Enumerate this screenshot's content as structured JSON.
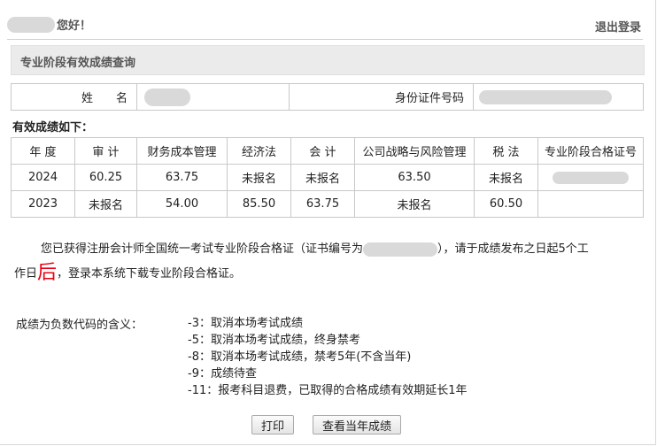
{
  "header": {
    "greeting": "您好！",
    "logout": "退出登录"
  },
  "section_title": "专业阶段有效成绩查询",
  "info": {
    "name_label": "姓　　名",
    "id_label": "身份证件号码"
  },
  "scores_heading": "有效成绩如下：",
  "columns": [
    "年 度",
    "审 计",
    "财务成本管理",
    "经济法",
    "会 计",
    "公司战略与风险管理",
    "税 法",
    "专业阶段合格证号"
  ],
  "rows": [
    [
      "2024",
      "60.25",
      "63.75",
      "未报名",
      "未报名",
      "63.50",
      "未报名"
    ],
    [
      "2023",
      "未报名",
      "54.00",
      "85.50",
      "63.75",
      "未报名",
      "60.50"
    ]
  ],
  "notice": {
    "part1": "您已获得注册会计师全国统一考试专业阶段合格证（证书编号为",
    "part2": "），请于成绩发布之日起5个工",
    "part3": "作日",
    "emphasis": "后",
    "part4": "，登录本系统下载专业阶段合格证。"
  },
  "codes_label": "成绩为负数代码的含义：",
  "codes": [
    "-3：取消本场考试成绩",
    "-5：取消本场考试成绩，终身禁考",
    "-8：取消本场考试成绩，禁考5年(不含当年)",
    "-9：成绩待查",
    "-11：报考科目退费，已取得的合格成绩有效期延长1年"
  ],
  "buttons": {
    "print": "打印",
    "current_year": "查看当年成绩"
  },
  "colors": {
    "emphasis": "#e60012",
    "section_bg": "#ebebeb",
    "border": "#c8c8c8"
  }
}
